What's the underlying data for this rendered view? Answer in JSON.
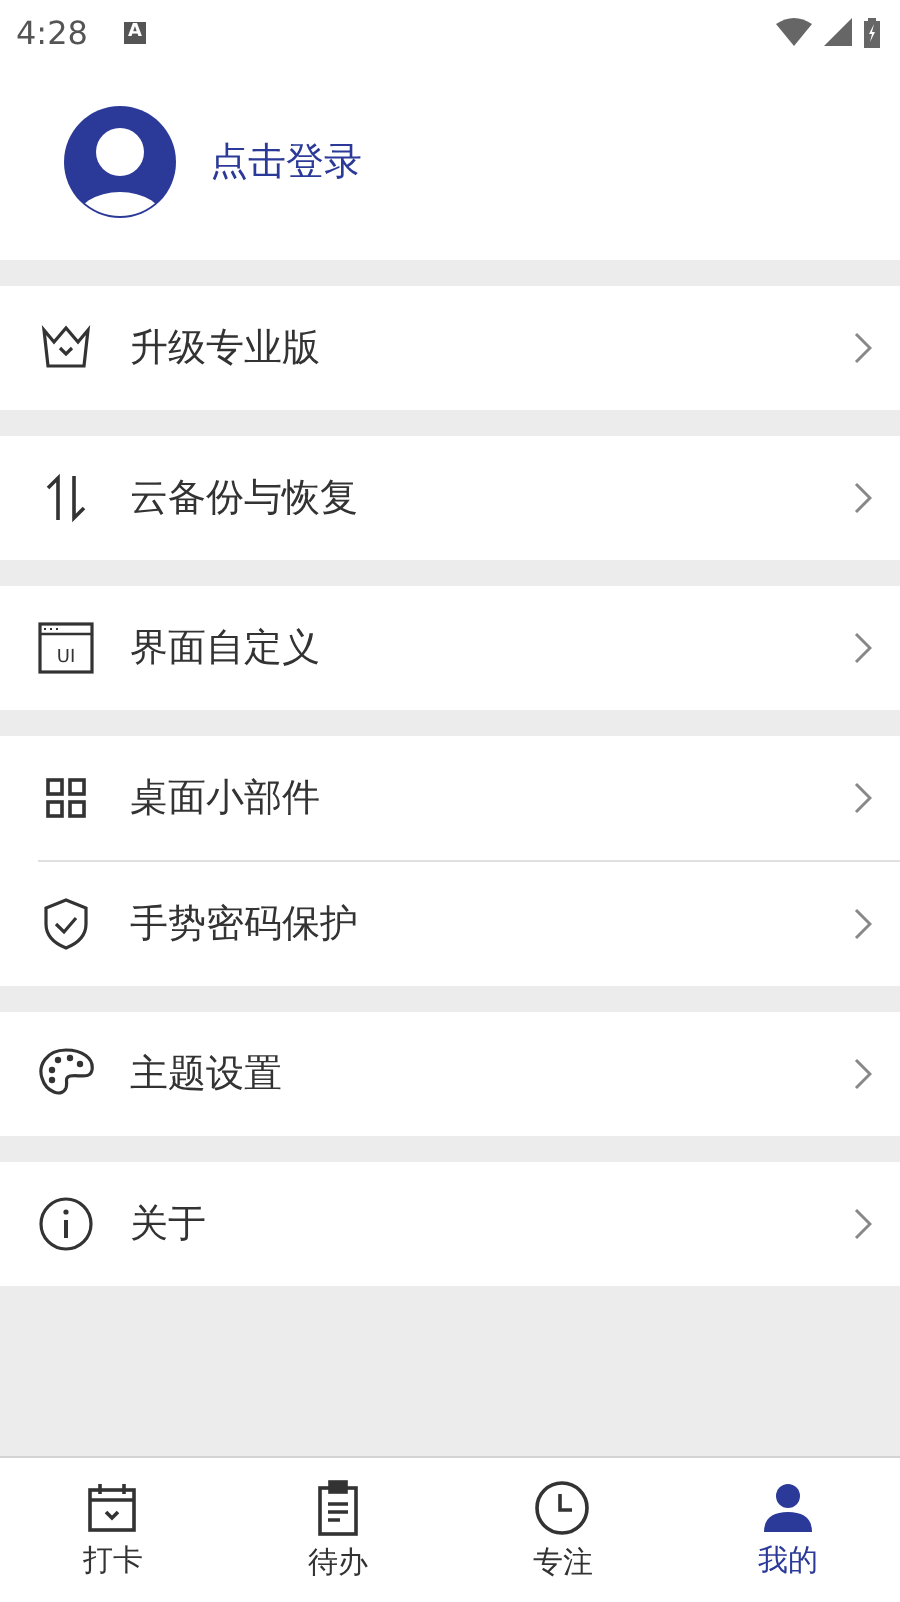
{
  "status_bar": {
    "time": "4:28",
    "notification": "A"
  },
  "profile": {
    "login": "点击登录"
  },
  "groups": [
    {
      "items": [
        {
          "kind": "crown",
          "label": "升级专业版"
        }
      ]
    },
    {
      "items": [
        {
          "kind": "sync",
          "label": "云备份与恢复"
        }
      ]
    },
    {
      "items": [
        {
          "kind": "ui",
          "icon_text": "UI",
          "label": "界面自定义"
        }
      ]
    },
    {
      "items": [
        {
          "kind": "widgets",
          "label": "桌面小部件"
        },
        {
          "kind": "shield",
          "label": "手势密码保护"
        }
      ]
    },
    {
      "items": [
        {
          "kind": "palette",
          "label": "主题设置"
        }
      ]
    },
    {
      "items": [
        {
          "kind": "info",
          "label": "关于"
        }
      ]
    }
  ],
  "tabs": [
    {
      "kind": "calendar",
      "label": "打卡",
      "selected": false
    },
    {
      "kind": "clipboard",
      "label": "待办",
      "selected": false
    },
    {
      "kind": "clock",
      "label": "专注",
      "selected": false
    },
    {
      "kind": "person",
      "label": "我的",
      "selected": true
    }
  ]
}
